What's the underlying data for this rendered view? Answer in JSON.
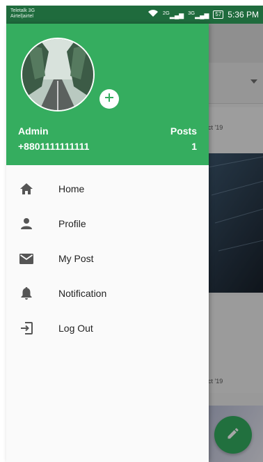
{
  "status_bar": {
    "carrier_line1": "Teletalk 3G",
    "carrier_line2": "Airtel|airtel",
    "signal1": "2G",
    "signal2": "3G",
    "battery": "57",
    "time": "5:36 PM"
  },
  "background": {
    "date1": "ct '19",
    "date2": "ct '19"
  },
  "drawer": {
    "user_name": "Admin",
    "phone": "+8801111111111",
    "posts_label": "Posts",
    "posts_count": "1",
    "menu": [
      {
        "label": "Home",
        "icon": "home-icon"
      },
      {
        "label": "Profile",
        "icon": "person-icon"
      },
      {
        "label": "My Post",
        "icon": "mail-icon"
      },
      {
        "label": "Notification",
        "icon": "bell-icon"
      },
      {
        "label": "Log Out",
        "icon": "logout-icon"
      }
    ]
  },
  "colors": {
    "primary": "#35ad5f",
    "status_bar": "#1f6b3d"
  }
}
